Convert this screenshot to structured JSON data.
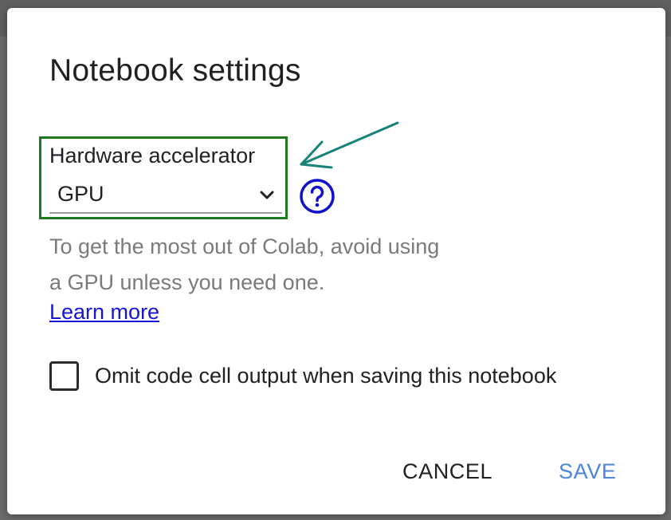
{
  "dialog": {
    "title": "Notebook settings"
  },
  "hardware": {
    "label": "Hardware accelerator",
    "selected": "GPU",
    "highlight_color": "#1b7a1b",
    "arrow_color": "#17827a"
  },
  "hint": {
    "text": "To get the most out of Colab, avoid using a GPU unless you need one.",
    "link": "Learn more"
  },
  "omit_output": {
    "label": "Omit code cell output when saving this notebook",
    "checked": false
  },
  "buttons": {
    "cancel": "CANCEL",
    "save": "SAVE"
  },
  "colors": {
    "link": "#1515d6",
    "save": "#4a86e0",
    "help_icon": "#1111cc"
  },
  "icons": {
    "select": "chevron-down-icon",
    "help": "help-circle-icon"
  }
}
